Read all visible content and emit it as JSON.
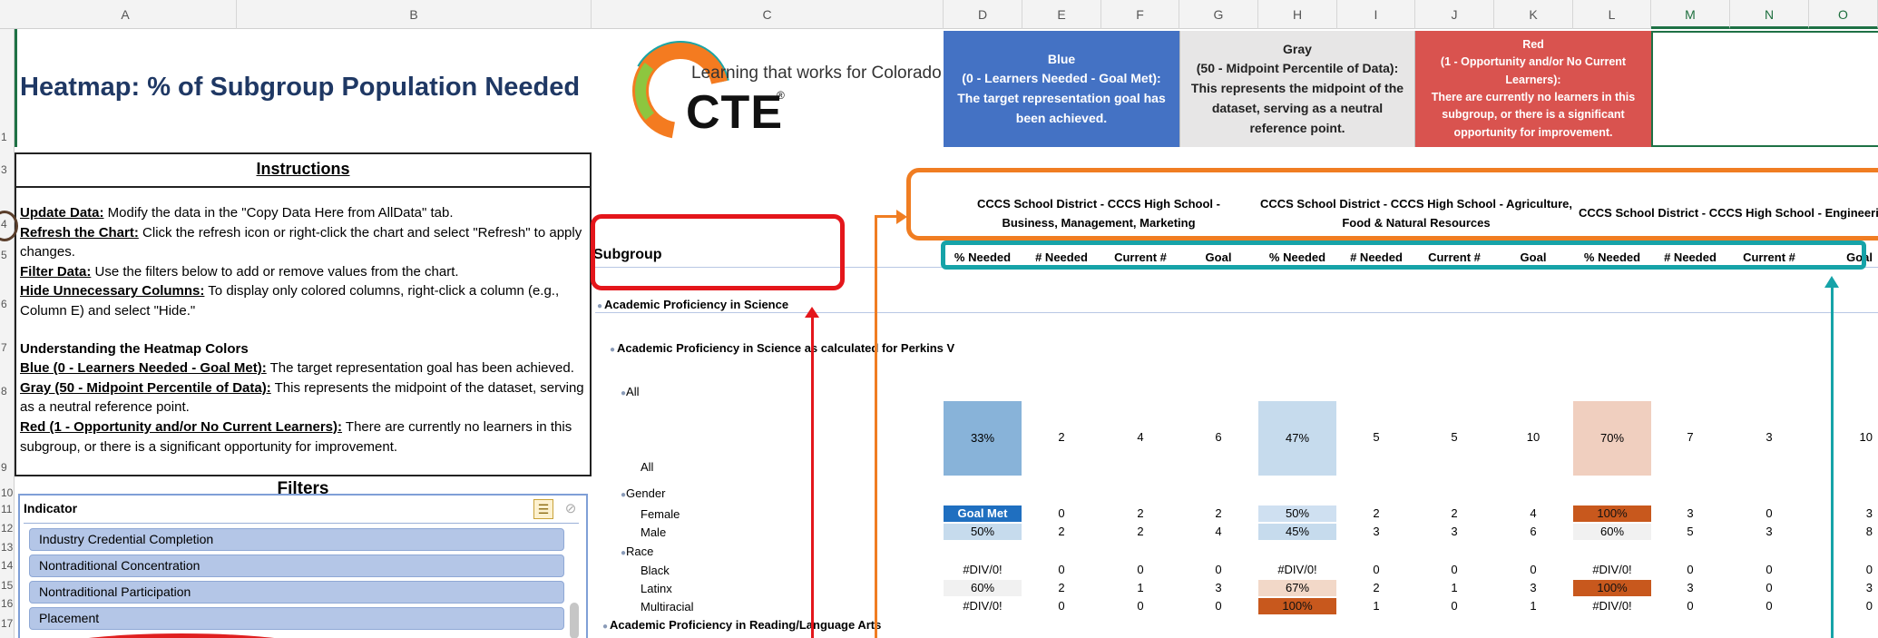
{
  "column_headers": [
    "A",
    "B",
    "C",
    "D",
    "E",
    "F",
    "G",
    "H",
    "I",
    "J",
    "K",
    "L",
    "M",
    "N",
    "O"
  ],
  "row_numbers": [
    "1",
    "3",
    "4",
    "5",
    "6",
    "7",
    "8",
    "9",
    "10",
    "11",
    "12",
    "13",
    "14",
    "15",
    "16",
    "17"
  ],
  "title": "Heatmap: % of Subgroup Population Needed",
  "logo": {
    "tagline": "Learning that works for Colorado",
    "wordmark": "CTE",
    "reg": "®"
  },
  "legend": {
    "blue": "Blue\n(0 - Learners Needed - Goal Met):\nThe target representation goal has been achieved.",
    "gray": "Gray\n(50 - Midpoint Percentile of Data):\nThis represents the midpoint of the dataset, serving as a neutral reference point.",
    "red": "Red\n(1 - Opportunity and/or No Current Learners):\nThere are currently no learners in this subgroup, or there is a significant opportunity for improvement.",
    "colors": {
      "blue": "#4472c4",
      "gray": "#e7e6e6",
      "red": "#d9534f"
    }
  },
  "instructions": {
    "title": "Instructions",
    "update_label": "Update Data:",
    "update_text": " Modify the data in the \"Copy Data Here from AllData\" tab.",
    "refresh_label": "Refresh the Chart:",
    "refresh_text": " Click the refresh icon or right-click the chart and select \"Refresh\" to apply changes.",
    "filter_label": "Filter Data:",
    "filter_text": " Use the filters below to add or remove values from the chart.",
    "hide_label": "Hide Unnecessary Columns:",
    "hide_text": " To display only colored columns, right-click a column (e.g., Column E) and select \"Hide.\"",
    "colors_heading": "Understanding the Heatmap Colors",
    "blue_label": "Blue (0 - Learners Needed - Goal Met):",
    "blue_text": " The target representation goal has been achieved.",
    "gray_label": "Gray (50 - Midpoint Percentile of Data):",
    "gray_text": " This represents the midpoint of the dataset, serving as a neutral reference point.",
    "red_label": "Red (1 - Opportunity and/or No Current Learners):",
    "red_text": " There are currently no learners in this subgroup, or there is a significant opportunity for improvement."
  },
  "filters": {
    "title": "Filters",
    "slicer_header": "Indicator",
    "items": [
      "Industry Credential Completion",
      "Nontraditional Concentration",
      "Nontraditional Participation",
      "Placement"
    ]
  },
  "table": {
    "subgroup_header": "Subgroup",
    "programs": [
      "CCCS School District - CCCS High School - Business, Management, Marketing",
      "CCCS School District - CCCS High School - Agriculture, Food & Natural Resources",
      "CCCS School District - CCCS High School - Engineerir"
    ],
    "column_labels": [
      "% Needed",
      "# Needed",
      "Current #",
      "Goal"
    ],
    "outline": {
      "level1a": "Academic Proficiency in Science",
      "level2": "Academic Proficiency in Science as calculated for Perkins V",
      "all_group": "All",
      "all_label": "All",
      "gender": "Gender",
      "race": "Race",
      "level1b": "Academic Proficiency in Reading/Language Arts"
    },
    "rows": [
      {
        "label": "All",
        "values": [
          "33%",
          "2",
          "4",
          "6",
          "47%",
          "5",
          "5",
          "10",
          "70%",
          "7",
          "3",
          "10"
        ]
      },
      {
        "label": "Female",
        "values": [
          "Goal Met",
          "0",
          "2",
          "2",
          "50%",
          "2",
          "2",
          "4",
          "100%",
          "3",
          "0",
          "3"
        ]
      },
      {
        "label": "Male",
        "values": [
          "50%",
          "2",
          "2",
          "4",
          "45%",
          "3",
          "3",
          "6",
          "60%",
          "5",
          "3",
          "8"
        ]
      },
      {
        "label": "Black",
        "values": [
          "#DIV/0!",
          "0",
          "0",
          "0",
          "#DIV/0!",
          "0",
          "0",
          "0",
          "#DIV/0!",
          "0",
          "0",
          "0"
        ]
      },
      {
        "label": "Latinx",
        "values": [
          "60%",
          "2",
          "1",
          "3",
          "67%",
          "2",
          "1",
          "3",
          "100%",
          "3",
          "0",
          "3"
        ]
      },
      {
        "label": "Multiracial",
        "values": [
          "#DIV/0!",
          "0",
          "0",
          "0",
          "100%",
          "1",
          "0",
          "1",
          "#DIV/0!",
          "0",
          "0",
          "0"
        ]
      }
    ],
    "heat_colors": {
      "all": [
        "#88b3d9",
        "#c6dbed",
        "#f0cfbf"
      ],
      "female": [
        "#1f6fc0",
        "#cfe0f1",
        "#c8581d"
      ],
      "male": [
        "#c6dbed",
        "#c6dbed",
        "#f1f1f1"
      ],
      "latinx": [
        "#f1f1f1",
        "#f2d8c8",
        "#c8581d"
      ],
      "multiracial": [
        "",
        "#c8581d",
        ""
      ]
    }
  }
}
